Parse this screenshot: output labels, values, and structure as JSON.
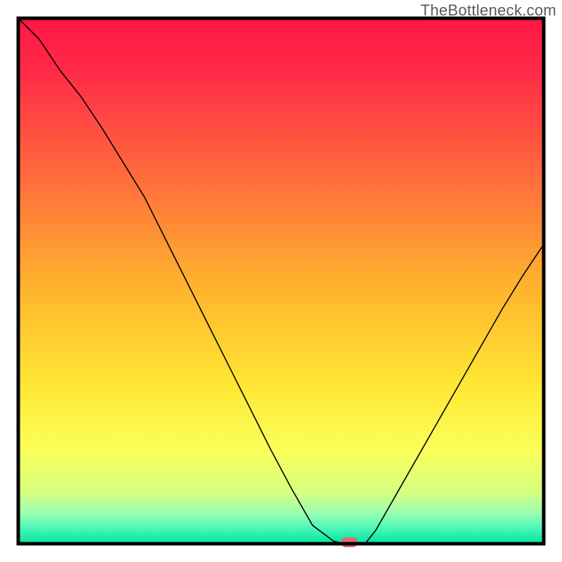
{
  "watermark": "TheBottleneck.com",
  "chart_data": {
    "type": "line",
    "title": "",
    "xlabel": "",
    "ylabel": "",
    "xlim": [
      0,
      100
    ],
    "ylim": [
      0,
      100
    ],
    "x": [
      0,
      4,
      8,
      12,
      16,
      20,
      24,
      28,
      32,
      36,
      40,
      44,
      48,
      52,
      56,
      60,
      62,
      64,
      66,
      68,
      72,
      76,
      80,
      84,
      88,
      92,
      96,
      100
    ],
    "y": [
      100,
      96,
      90,
      85,
      79,
      72.5,
      66,
      58,
      50,
      42,
      34,
      26,
      18,
      10.5,
      3.5,
      0.5,
      0,
      0,
      0,
      2.5,
      9.5,
      16.5,
      23.5,
      30.5,
      37.5,
      44.5,
      51,
      57
    ],
    "optimal_x": 63,
    "marker_color": "#e46a6f",
    "gradient_stops": [
      {
        "offset": 0.0,
        "color": "#ff1744"
      },
      {
        "offset": 0.1,
        "color": "#ff2a47"
      },
      {
        "offset": 0.3,
        "color": "#ff6b3d"
      },
      {
        "offset": 0.5,
        "color": "#ffb02e"
      },
      {
        "offset": 0.7,
        "color": "#ffe733"
      },
      {
        "offset": 0.82,
        "color": "#faff5a"
      },
      {
        "offset": 0.9,
        "color": "#d8ff7e"
      },
      {
        "offset": 0.94,
        "color": "#9dffb0"
      },
      {
        "offset": 0.97,
        "color": "#4cf7b8"
      },
      {
        "offset": 1.0,
        "color": "#00e3a0"
      }
    ]
  }
}
